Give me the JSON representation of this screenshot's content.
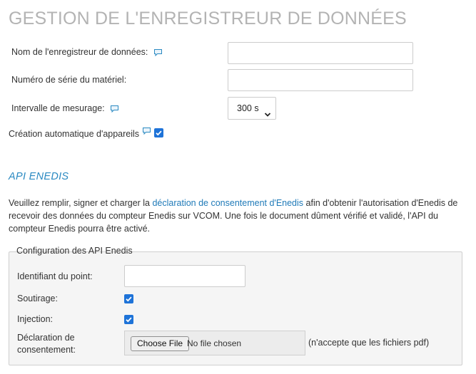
{
  "page_title": "GESTION DE L'ENREGISTREUR DE DONNÉES",
  "logger": {
    "name_label": "Nom de l'enregistreur de données:",
    "name_value": "",
    "serial_label": "Numéro de série du matériel:",
    "serial_value": "",
    "interval_label": "Intervalle de mesurage:",
    "interval_value": "300 s",
    "auto_create_label": "Création automatique d'appareils",
    "auto_create_checked": true
  },
  "api": {
    "section_title": "API ENEDIS",
    "intro_before": "Veuillez remplir, signer et charger la ",
    "intro_link": "déclaration de consentement d'Enedis",
    "intro_after": " afin d'obtenir l'autorisation d'Enedis de recevoir des données du compteur Enedis sur VCOM. Une fois le document dûment vérifié et validé, l'API du compteur Enedis pourra être activé.",
    "config_legend": "Configuration des API Enedis",
    "point_id_label": "Identifiant du point:",
    "point_id_value": "",
    "soutirage_label": "Soutirage:",
    "soutirage_checked": true,
    "injection_label": "Injection:",
    "injection_checked": true,
    "consent_label_line1": "Déclaration de",
    "consent_label_line2": "consentement:",
    "file_button": "Choose File",
    "file_status": "No file chosen",
    "file_hint": "(n'accepte que les fichiers pdf)"
  },
  "colors": {
    "accent_link": "#1f7ab8",
    "section_title": "#2b8ac2",
    "checkbox": "#1e73d8",
    "title_gray": "#b3b3b3"
  },
  "icons": {
    "info": "speech-bubble-icon",
    "select_arrow": "chevron-down-icon",
    "check": "check-icon"
  }
}
